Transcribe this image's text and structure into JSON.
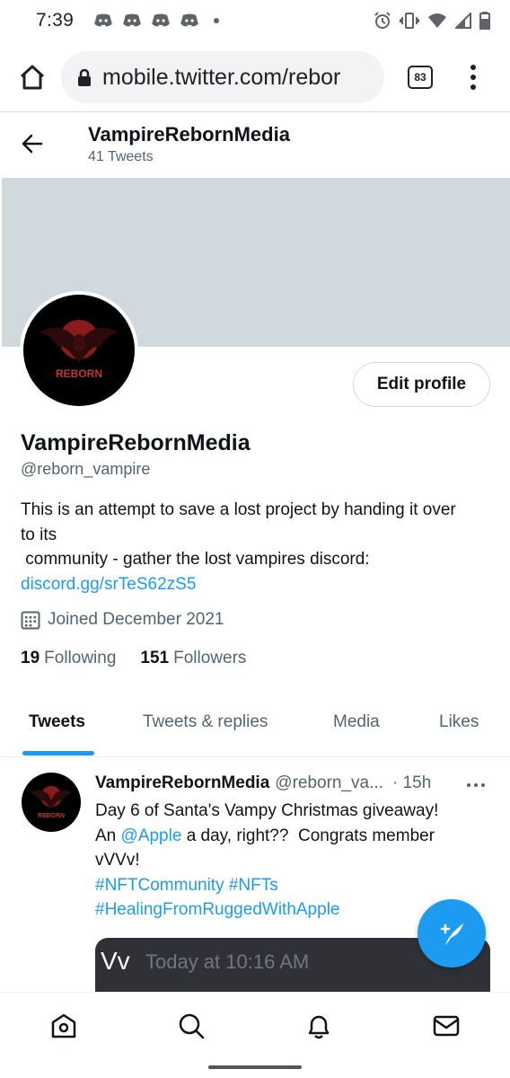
{
  "status_bar": {
    "time": "7:39",
    "icons": [
      "discord-icon",
      "discord-icon",
      "discord-icon",
      "discord-icon",
      "notification-dot",
      "alarm-icon",
      "vibrate-icon",
      "wifi-icon",
      "signal-icon",
      "battery-icon"
    ]
  },
  "browser": {
    "url": "mobile.twitter.com/rebor",
    "tab_count": "83",
    "icons": [
      "home-icon",
      "lock-icon",
      "more-vert-icon"
    ]
  },
  "profile_header": {
    "name": "VampireRebornMedia",
    "tweet_count": "41 Tweets"
  },
  "profile": {
    "banner_color": "#cfd9de",
    "avatar_text": "REBORN",
    "edit_button": "Edit profile",
    "display_name": "VampireRebornMedia",
    "handle": "@reborn_vampire",
    "bio_lines": [
      "This is an attempt to save a lost project by handing it over",
      "to its",
      " community - gather the lost vampires discord:"
    ],
    "bio_link": "discord.gg/srTeS62zS5",
    "joined": "Joined December 2021",
    "following_count": "19",
    "following_label": "Following",
    "followers_count": "151",
    "followers_label": "Followers"
  },
  "tabs": [
    {
      "label": "Tweets",
      "active": true
    },
    {
      "label": "Tweets & replies",
      "active": false
    },
    {
      "label": "Media",
      "active": false
    },
    {
      "label": "Likes",
      "active": false
    }
  ],
  "tweet": {
    "name": "VampireRebornMedia",
    "handle": "@reborn_va...",
    "time": "· 15h",
    "line1": "Day 6 of Santa's Vampy Christmas giveaway!",
    "line2_pre": "An ",
    "line2_mention": "@Apple",
    "line2_post": " a day, right??  Congrats member",
    "line3": "vVVv!",
    "hashtags1": "#NFTCommunity #NFTs",
    "hashtags2": "#HealingFromRuggedWithApple",
    "image_user": "Vv",
    "image_time": "Today at 10:16 AM"
  },
  "bottom_nav": [
    "home-icon",
    "search-icon",
    "notifications-icon",
    "messages-icon"
  ],
  "colors": {
    "accent": "#1d9bf0",
    "secondary_text": "#536471",
    "primary_text": "#0f1419"
  }
}
